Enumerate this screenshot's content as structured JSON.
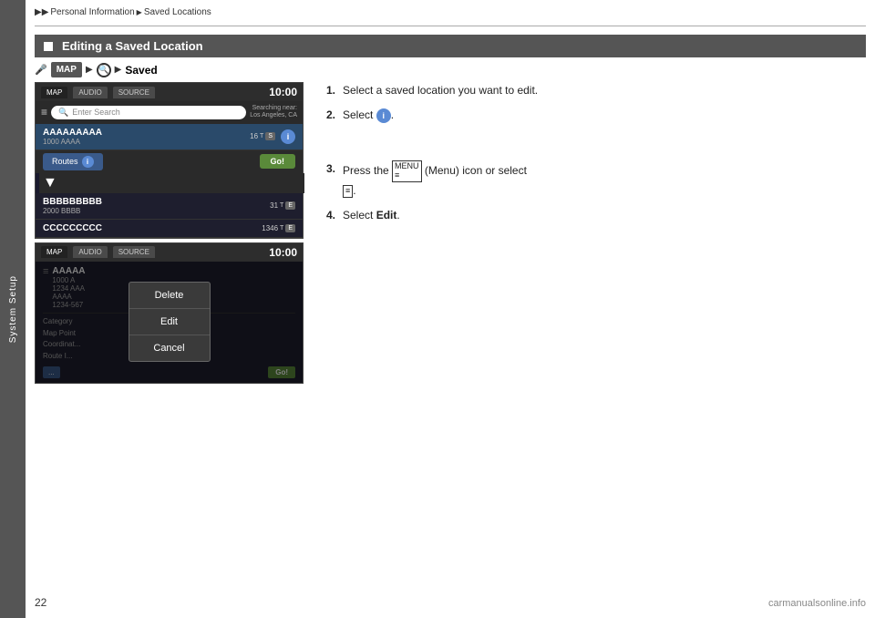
{
  "sidebar": {
    "label": "System Setup"
  },
  "breadcrumb": {
    "arrows": "▶▶",
    "part1": "Personal Information",
    "arrow2": "▶",
    "part2": "Saved Locations"
  },
  "section_header": {
    "title": "Editing a Saved Location"
  },
  "nav": {
    "icon": "🎤",
    "map_label": "MAP",
    "arrow1": "▶",
    "circle_icon": "🔍",
    "arrow2": "▶",
    "saved_label": "Saved"
  },
  "screen1": {
    "tabs": [
      "MAP",
      "AUDIO",
      "SOURCE"
    ],
    "time": "10:00",
    "menu_icon": "≡",
    "search_placeholder": "Enter Search",
    "near_label": "Searching near:",
    "near_city": "Los Angeles, CA",
    "items": [
      {
        "name": "AAAAAAAAA",
        "sub": "1000 AAAA",
        "dist": "16",
        "unit": "T",
        "badge": "S",
        "has_info": true,
        "has_routes": true,
        "has_go": true
      },
      {
        "name": "BBBBBBBBB",
        "sub": "2000 BBBB",
        "dist": "31",
        "unit": "T",
        "badge": "E"
      },
      {
        "name": "CCCCCCCCC",
        "sub": "",
        "dist": "1346",
        "unit": "T",
        "badge": "E"
      }
    ]
  },
  "screen2": {
    "tabs": [
      "MAP",
      "AUDIO",
      "SOURCE"
    ],
    "time": "10:00",
    "menu_icon": "≡",
    "top_name": "AAAAA",
    "top_sub1": "1000 A",
    "top_sub2": "1234 AAA",
    "top_sub3": "AAAA",
    "top_sub4": "1234-567",
    "category_label": "Category",
    "map_point": "Map Point",
    "coordinates": "Coordinat...",
    "route_label": "Route I...",
    "modal": {
      "delete": "Delete",
      "edit": "Edit",
      "cancel": "Cancel"
    }
  },
  "instructions": {
    "step1_num": "1.",
    "step1_text": "Select a saved location you want to edit.",
    "step2_num": "2.",
    "step2_text": "Select",
    "step3_num": "3.",
    "step3a": "Press the",
    "step3b": "(Menu) icon or select",
    "step4_num": "4.",
    "step4a": "Select ",
    "step4b": "Edit"
  },
  "page_number": "22",
  "watermark": "carmanualsonline.info"
}
